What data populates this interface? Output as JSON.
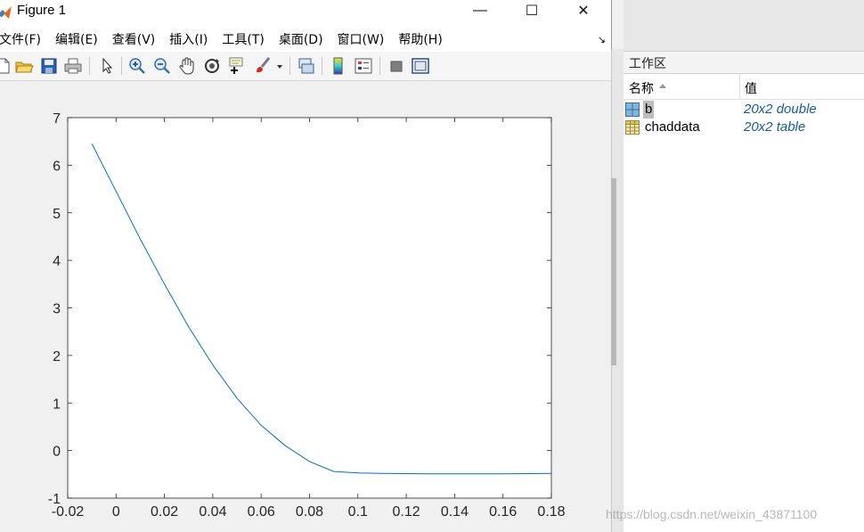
{
  "figure_window": {
    "title": "Figure 1",
    "app_icon": "matlab-icon",
    "controls": {
      "minimize": "—",
      "maximize": "☐",
      "close": "✕"
    }
  },
  "menubar": {
    "items": [
      {
        "label": "文件(F)"
      },
      {
        "label": "编辑(E)"
      },
      {
        "label": "查看(V)"
      },
      {
        "label": "插入(I)"
      },
      {
        "label": "工具(T)"
      },
      {
        "label": "桌面(D)"
      },
      {
        "label": "窗口(W)"
      },
      {
        "label": "帮助(H)"
      }
    ],
    "dock_arrow": "↘"
  },
  "toolbar": {
    "buttons": [
      "new-figure-icon",
      "open-file-icon",
      "save-icon",
      "print-icon",
      "edit-plot-arrow-icon",
      "zoom-in-icon",
      "zoom-out-icon",
      "pan-hand-icon",
      "rotate-3d-icon",
      "data-cursor-icon",
      "brush-icon",
      "link-plot-icon",
      "colorbar-icon",
      "legend-icon",
      "hide-plot-tools-icon",
      "show-plot-tools-icon"
    ]
  },
  "chart_data": {
    "type": "line",
    "title": "",
    "xlabel": "",
    "ylabel": "",
    "xlim": [
      -0.02,
      0.18
    ],
    "ylim": [
      -1,
      7
    ],
    "xticks": [
      "-0.02",
      "0",
      "0.02",
      "0.04",
      "0.06",
      "0.08",
      "0.1",
      "0.12",
      "0.14",
      "0.16",
      "0.18"
    ],
    "yticks": [
      "-1",
      "0",
      "1",
      "2",
      "3",
      "4",
      "5",
      "6",
      "7"
    ],
    "grid": false,
    "line_color": "#0072bd",
    "series": [
      {
        "x": [
          -0.01,
          0.0,
          0.01,
          0.02,
          0.03,
          0.04,
          0.05,
          0.06,
          0.07,
          0.08,
          0.09,
          0.1,
          0.11,
          0.12,
          0.13,
          0.14,
          0.15,
          0.16,
          0.17,
          0.18
        ],
        "y": [
          6.45,
          5.45,
          4.45,
          3.5,
          2.6,
          1.8,
          1.1,
          0.53,
          0.1,
          -0.23,
          -0.44,
          -0.47,
          -0.48,
          -0.485,
          -0.49,
          -0.49,
          -0.49,
          -0.49,
          -0.485,
          -0.48
        ]
      }
    ]
  },
  "workspace": {
    "title": "工作区",
    "columns": {
      "name": "名称",
      "value": "值"
    },
    "variables": [
      {
        "name": "b",
        "value": "20x2 double",
        "icon": "matrix-icon"
      },
      {
        "name": "chaddata",
        "value": "20x2 table",
        "icon": "table-icon"
      }
    ]
  },
  "watermark": "https://blog.csdn.net/weixin_43871100"
}
